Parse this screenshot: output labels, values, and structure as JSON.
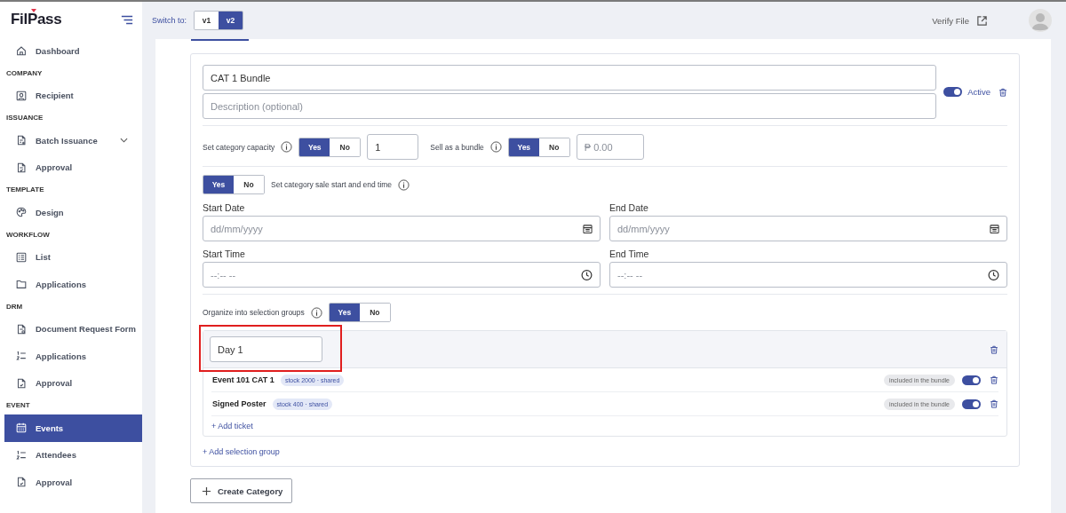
{
  "sidebar": {
    "logo": "FilPass",
    "sections": [
      {
        "items": [
          {
            "label": "Dashboard",
            "selected": false
          }
        ]
      },
      {
        "title": "COMPANY",
        "items": [
          {
            "label": "Recipient",
            "selected": false
          }
        ]
      },
      {
        "title": "ISSUANCE",
        "items": [
          {
            "label": "Batch Issuance",
            "selected": false,
            "expanded": false
          },
          {
            "label": "Approval",
            "selected": false
          }
        ]
      },
      {
        "title": "TEMPLATE",
        "items": [
          {
            "label": "Design",
            "selected": false
          }
        ]
      },
      {
        "title": "WORKFLOW",
        "items": [
          {
            "label": "List",
            "selected": false
          },
          {
            "label": "Applications",
            "selected": false
          }
        ]
      },
      {
        "title": "DRM",
        "items": [
          {
            "label": "Document Request Form",
            "selected": false
          },
          {
            "label": "Applications",
            "selected": false
          },
          {
            "label": "Approval",
            "selected": false
          }
        ]
      },
      {
        "title": "EVENT",
        "items": [
          {
            "label": "Events",
            "selected": true
          },
          {
            "label": "Attendees",
            "selected": false
          },
          {
            "label": "Approval",
            "selected": false
          }
        ]
      }
    ]
  },
  "topbar": {
    "switch_label": "Switch to:",
    "versions": [
      {
        "label": "v1",
        "selected": false
      },
      {
        "label": "v2",
        "selected": true
      }
    ],
    "verify_link": "Verify File"
  },
  "category": {
    "name": "CAT 1 Bundle",
    "description_placeholder": "Description (optional)",
    "active": true,
    "active_label": "Active",
    "capacity": {
      "label": "Set category capacity",
      "options": [
        {
          "label": "Yes",
          "selected": true
        },
        {
          "label": "No",
          "selected": false
        }
      ],
      "value": "1"
    },
    "bundle": {
      "label": "Sell as a bundle",
      "options": [
        {
          "label": "Yes",
          "selected": true
        },
        {
          "label": "No",
          "selected": false
        }
      ],
      "placeholder": "₱ 0.00"
    },
    "schedule": {
      "options": [
        {
          "label": "Yes",
          "selected": true
        },
        {
          "label": "No",
          "selected": false
        }
      ],
      "label": "Set category sale start and end time",
      "fields": [
        {
          "kind": "date",
          "label": "Start Date",
          "placeholder": "dd/mm/yyyy"
        },
        {
          "kind": "date",
          "label": "End Date",
          "placeholder": "dd/mm/yyyy"
        },
        {
          "kind": "time",
          "label": "Start Time",
          "placeholder": "--:-- --"
        },
        {
          "kind": "time",
          "label": "End Time",
          "placeholder": "--:-- --"
        }
      ]
    },
    "groups_toggle": {
      "label": "Organize into selection groups",
      "options": [
        {
          "label": "Yes",
          "selected": true
        },
        {
          "label": "No",
          "selected": false
        }
      ]
    },
    "groups": [
      {
        "name": "Day 1",
        "tickets": [
          {
            "name": "Event 101 CAT 1",
            "stock": "stock 2000 · shared",
            "status": "included in the bundle",
            "on": true
          },
          {
            "name": "Signed Poster",
            "stock": "stock 400 · shared",
            "status": "included in the bundle",
            "on": true
          }
        ],
        "add_ticket": "+ Add ticket"
      }
    ],
    "add_group": "+ Add selection group"
  },
  "create_button": "Create Category"
}
